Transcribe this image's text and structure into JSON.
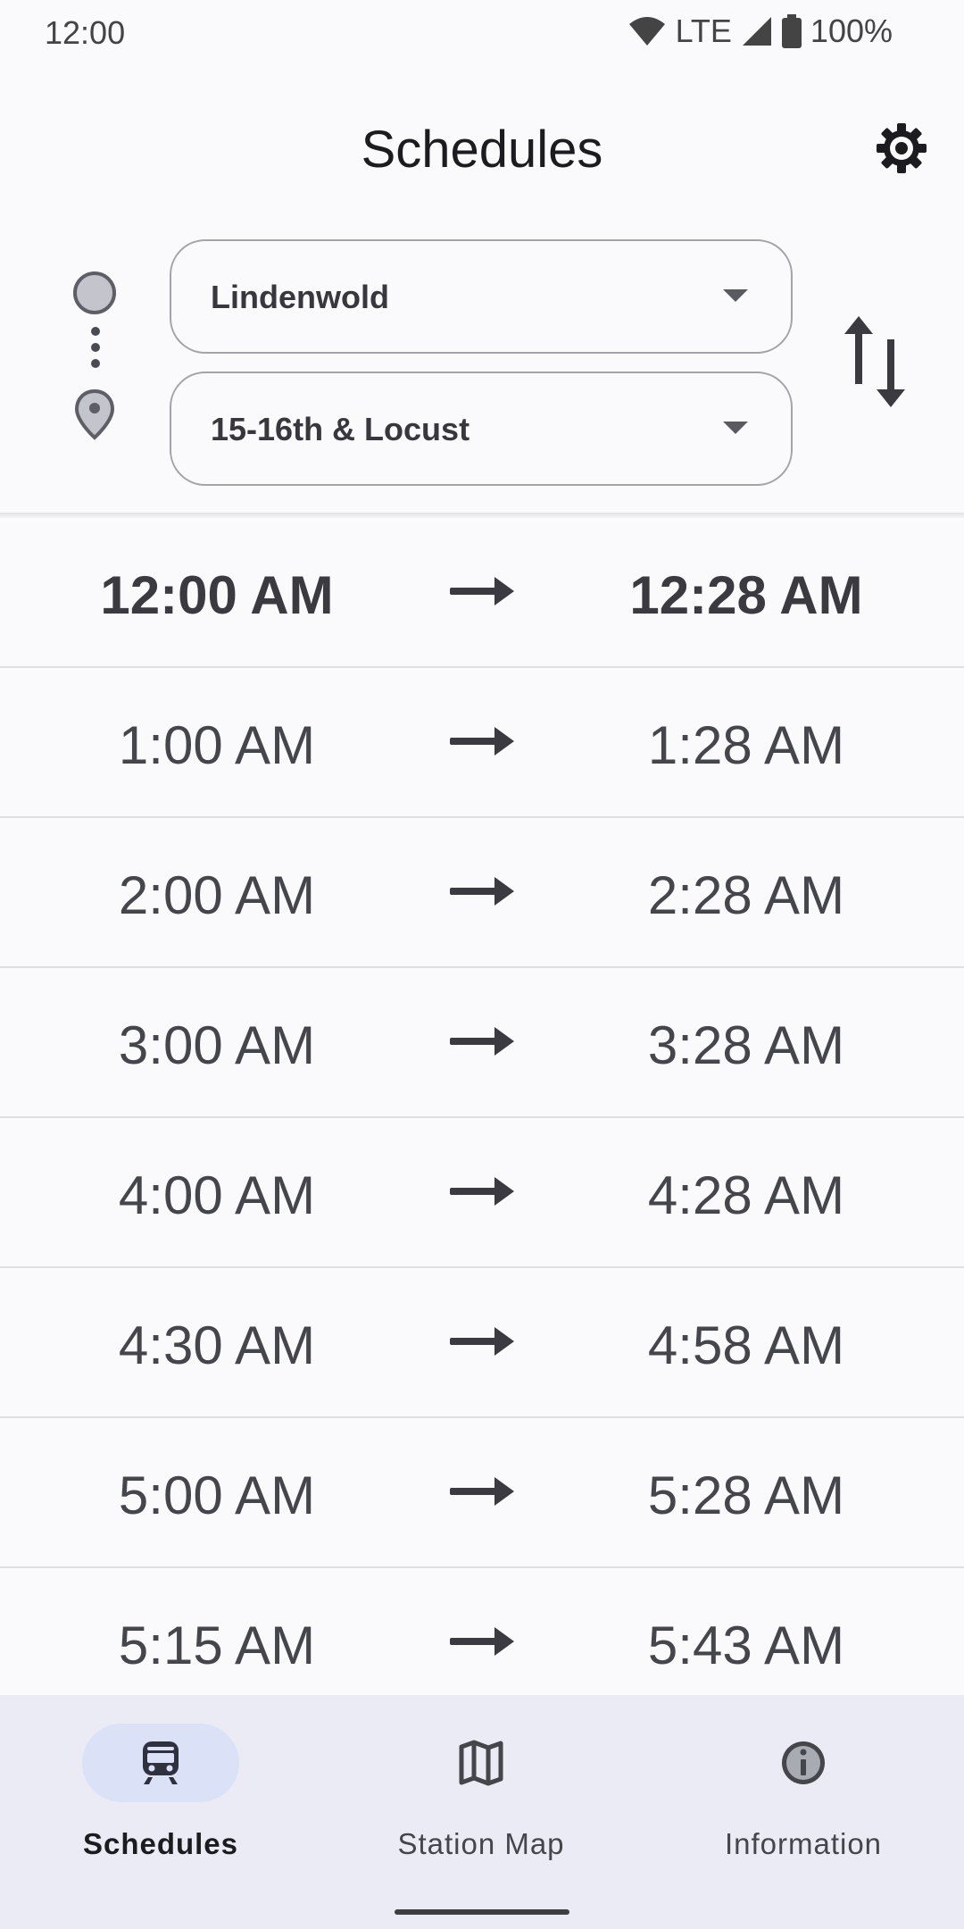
{
  "status_bar": {
    "time": "12:00",
    "network": "LTE",
    "battery": "100%"
  },
  "app_bar": {
    "title": "Schedules",
    "settings_icon": "gear-icon"
  },
  "selector": {
    "origin": "Lindenwold",
    "destination": "15-16th & Locust",
    "swap_icon": "swap-vertical-icon"
  },
  "trips": [
    {
      "depart": "12:00 AM",
      "arrive": "12:28 AM",
      "next": true
    },
    {
      "depart": "1:00 AM",
      "arrive": "1:28 AM",
      "next": false
    },
    {
      "depart": "2:00 AM",
      "arrive": "2:28 AM",
      "next": false
    },
    {
      "depart": "3:00 AM",
      "arrive": "3:28 AM",
      "next": false
    },
    {
      "depart": "4:00 AM",
      "arrive": "4:28 AM",
      "next": false
    },
    {
      "depart": "4:30 AM",
      "arrive": "4:58 AM",
      "next": false
    },
    {
      "depart": "5:00 AM",
      "arrive": "5:28 AM",
      "next": false
    },
    {
      "depart": "5:15 AM",
      "arrive": "5:43 AM",
      "next": false
    }
  ],
  "bottom_nav": {
    "items": [
      {
        "label": "Schedules",
        "icon": "train-icon",
        "active": true
      },
      {
        "label": "Station Map",
        "icon": "map-icon",
        "active": false
      },
      {
        "label": "Information",
        "icon": "info-icon",
        "active": false
      }
    ]
  },
  "colors": {
    "background": "#fafafd",
    "nav_background": "#eaebf5",
    "active_pill": "#dbe1f7",
    "text_primary": "#1c1b1f",
    "text_secondary": "#45454c"
  }
}
